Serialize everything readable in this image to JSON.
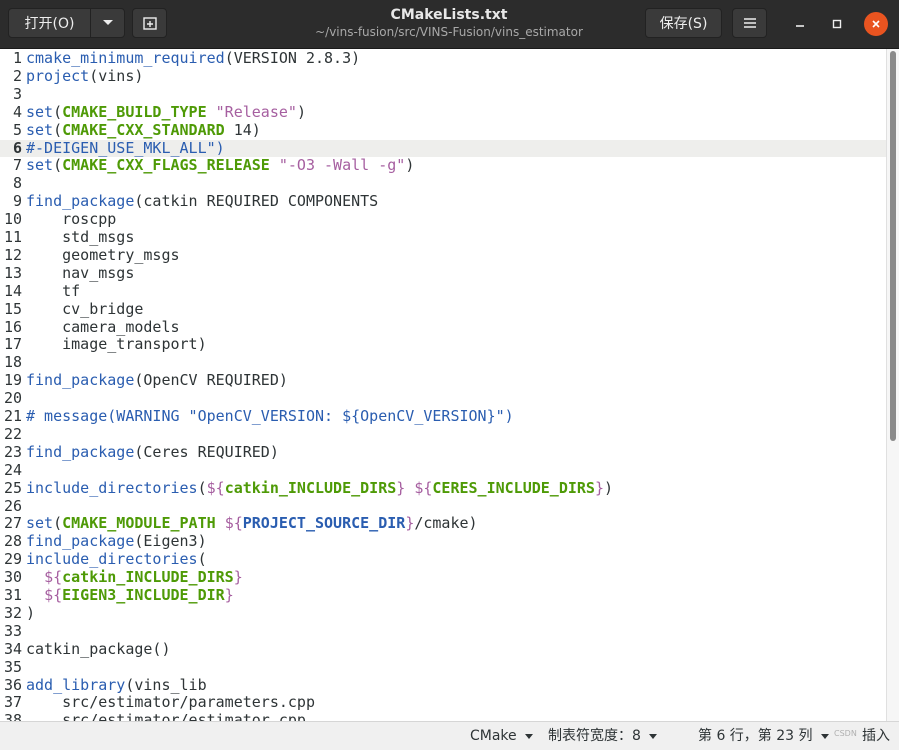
{
  "window": {
    "title": "CMakeLists.txt",
    "path": "~/vins-fusion/src/VINS-Fusion/vins_estimator",
    "open_label": "打开(O)",
    "save_label": "保存(S)"
  },
  "icons": {
    "dropdown": "chevron-down-icon",
    "new_tab": "new-tab-icon",
    "menu": "hamburger-menu-icon",
    "minimize": "minimize-icon",
    "maximize": "maximize-icon",
    "close": "close-icon"
  },
  "colors": {
    "keyword": "#2a5db0",
    "variable": "#4e9a06",
    "string": "#a65fa0",
    "current_line": "#eeeeec",
    "close_button": "#e95420"
  },
  "editor": {
    "current_line": 6,
    "lines": [
      {
        "n": "1",
        "toks": [
          [
            "k",
            "cmake_minimum_required"
          ],
          [
            "p",
            "(VERSION 2.8.3)"
          ]
        ]
      },
      {
        "n": "2",
        "toks": [
          [
            "k",
            "project"
          ],
          [
            "p",
            "(vins)"
          ]
        ]
      },
      {
        "n": "3",
        "toks": []
      },
      {
        "n": "4",
        "toks": [
          [
            "k",
            "set"
          ],
          [
            "p",
            "("
          ],
          [
            "v",
            "CMAKE_BUILD_TYPE"
          ],
          [
            "p",
            " "
          ],
          [
            "s",
            "\"Release\""
          ],
          [
            "p",
            ")"
          ]
        ]
      },
      {
        "n": "5",
        "toks": [
          [
            "k",
            "set"
          ],
          [
            "p",
            "("
          ],
          [
            "v",
            "CMAKE_CXX_STANDARD"
          ],
          [
            "p",
            " 14)"
          ]
        ]
      },
      {
        "n": "6",
        "toks": [
          [
            "c",
            "#-DEIGEN_USE_MKL_ALL\")"
          ]
        ]
      },
      {
        "n": "7",
        "toks": [
          [
            "k",
            "set"
          ],
          [
            "p",
            "("
          ],
          [
            "v",
            "CMAKE_CXX_FLAGS_RELEASE"
          ],
          [
            "p",
            " "
          ],
          [
            "s",
            "\"-O3 -Wall -g\""
          ],
          [
            "p",
            ")"
          ]
        ]
      },
      {
        "n": "8",
        "toks": []
      },
      {
        "n": "9",
        "toks": [
          [
            "k",
            "find_package"
          ],
          [
            "p",
            "(catkin REQUIRED COMPONENTS"
          ]
        ]
      },
      {
        "n": "10",
        "toks": [
          [
            "p",
            "    roscpp"
          ]
        ]
      },
      {
        "n": "11",
        "toks": [
          [
            "p",
            "    std_msgs"
          ]
        ]
      },
      {
        "n": "12",
        "toks": [
          [
            "p",
            "    geometry_msgs"
          ]
        ]
      },
      {
        "n": "13",
        "toks": [
          [
            "p",
            "    nav_msgs"
          ]
        ]
      },
      {
        "n": "14",
        "toks": [
          [
            "p",
            "    tf"
          ]
        ]
      },
      {
        "n": "15",
        "toks": [
          [
            "p",
            "    cv_bridge"
          ]
        ]
      },
      {
        "n": "16",
        "toks": [
          [
            "p",
            "    camera_models"
          ]
        ]
      },
      {
        "n": "17",
        "toks": [
          [
            "p",
            "    image_transport)"
          ]
        ]
      },
      {
        "n": "18",
        "toks": []
      },
      {
        "n": "19",
        "toks": [
          [
            "k",
            "find_package"
          ],
          [
            "p",
            "(OpenCV REQUIRED)"
          ]
        ]
      },
      {
        "n": "20",
        "toks": []
      },
      {
        "n": "21",
        "toks": [
          [
            "c",
            "# message(WARNING \"OpenCV_VERSION: ${OpenCV_VERSION}\")"
          ]
        ]
      },
      {
        "n": "22",
        "toks": []
      },
      {
        "n": "23",
        "toks": [
          [
            "k",
            "find_package"
          ],
          [
            "p",
            "(Ceres REQUIRED)"
          ]
        ]
      },
      {
        "n": "24",
        "toks": []
      },
      {
        "n": "25",
        "toks": [
          [
            "k",
            "include_directories"
          ],
          [
            "p",
            "("
          ],
          [
            "s",
            "${"
          ],
          [
            "v",
            "catkin_INCLUDE_DIRS"
          ],
          [
            "s",
            "}"
          ],
          [
            "p",
            " "
          ],
          [
            "s",
            "${"
          ],
          [
            "v",
            "CERES_INCLUDE_DIRS"
          ],
          [
            "s",
            "}"
          ],
          [
            "p",
            ")"
          ]
        ]
      },
      {
        "n": "26",
        "toks": []
      },
      {
        "n": "27",
        "toks": [
          [
            "k",
            "set"
          ],
          [
            "p",
            "("
          ],
          [
            "v",
            "CMAKE_MODULE_PATH"
          ],
          [
            "p",
            " "
          ],
          [
            "s",
            "${"
          ],
          [
            "r",
            "PROJECT_SOURCE_DIR"
          ],
          [
            "s",
            "}"
          ],
          [
            "p",
            "/cmake)"
          ]
        ]
      },
      {
        "n": "28",
        "toks": [
          [
            "k",
            "find_package"
          ],
          [
            "p",
            "(Eigen3)"
          ]
        ]
      },
      {
        "n": "29",
        "toks": [
          [
            "k",
            "include_directories"
          ],
          [
            "p",
            "("
          ]
        ]
      },
      {
        "n": "30",
        "toks": [
          [
            "p",
            "  "
          ],
          [
            "s",
            "${"
          ],
          [
            "v",
            "catkin_INCLUDE_DIRS"
          ],
          [
            "s",
            "}"
          ]
        ]
      },
      {
        "n": "31",
        "toks": [
          [
            "p",
            "  "
          ],
          [
            "s",
            "${"
          ],
          [
            "v",
            "EIGEN3_INCLUDE_DIR"
          ],
          [
            "s",
            "}"
          ]
        ]
      },
      {
        "n": "32",
        "toks": [
          [
            "p",
            ")"
          ]
        ]
      },
      {
        "n": "33",
        "toks": []
      },
      {
        "n": "34",
        "toks": [
          [
            "p",
            "catkin_package()"
          ]
        ]
      },
      {
        "n": "35",
        "toks": []
      },
      {
        "n": "36",
        "toks": [
          [
            "k",
            "add_library"
          ],
          [
            "p",
            "(vins_lib"
          ]
        ]
      },
      {
        "n": "37",
        "toks": [
          [
            "p",
            "    src/estimator/parameters.cpp"
          ]
        ]
      },
      {
        "n": "38",
        "toks": [
          [
            "p",
            "    src/estimator/estimator.cpp"
          ]
        ]
      }
    ]
  },
  "statusbar": {
    "language": "CMake",
    "tab_width": "制表符宽度：8",
    "position": "第 6 行，第 23 列",
    "mode": "插入",
    "watermark": "CSDN"
  }
}
